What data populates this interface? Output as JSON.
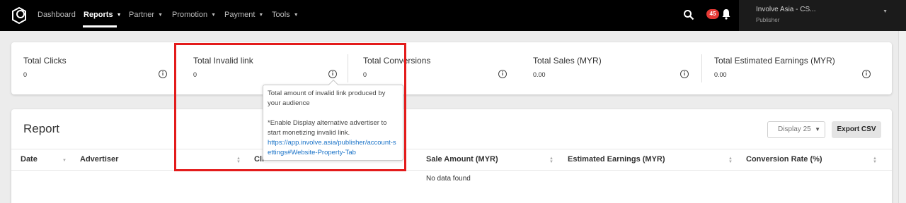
{
  "navbar": {
    "items": [
      {
        "label": "Dashboard",
        "has_caret": false
      },
      {
        "label": "Reports",
        "has_caret": true,
        "active": true
      },
      {
        "label": "Partner",
        "has_caret": true
      },
      {
        "label": "Promotion",
        "has_caret": true
      },
      {
        "label": "Payment",
        "has_caret": true
      },
      {
        "label": "Tools",
        "has_caret": true
      }
    ],
    "icons": {
      "logo": "involve-logo-icon",
      "search": "search-icon",
      "notifications": "bell-icon"
    },
    "notification_count": "45",
    "account": {
      "name": "Involve Asia - CS...",
      "role": "Publisher"
    }
  },
  "stats": [
    {
      "label": "Total Clicks",
      "value": "0"
    },
    {
      "label": "Total Invalid link",
      "value": "0"
    },
    {
      "label": "Total Conversions",
      "value": "0"
    },
    {
      "label": "Total Sales (MYR)",
      "value": "0.00"
    },
    {
      "label": "Total Estimated Earnings (MYR)",
      "value": "0.00"
    }
  ],
  "tooltip": {
    "line1": "Total amount of invalid link produced by your audience",
    "line2": "*Enable Display alternative advertiser to start monetizing invalid link.",
    "link": "https://app.involve.asia/publisher/account-settings#Website-Property-Tab"
  },
  "report": {
    "title": "Report",
    "display_select": "Display 25",
    "export_label": "Export CSV",
    "columns": [
      "Date",
      "Advertiser",
      "Cli",
      "Sale Amount (MYR)",
      "Estimated Earnings (MYR)",
      "Conversion Rate (%)"
    ],
    "empty_text": "No data found"
  },
  "colors": {
    "navbar_bg": "#000000",
    "highlight_border": "#e31b1b",
    "badge": "#e53935",
    "link": "#1a73c8"
  }
}
